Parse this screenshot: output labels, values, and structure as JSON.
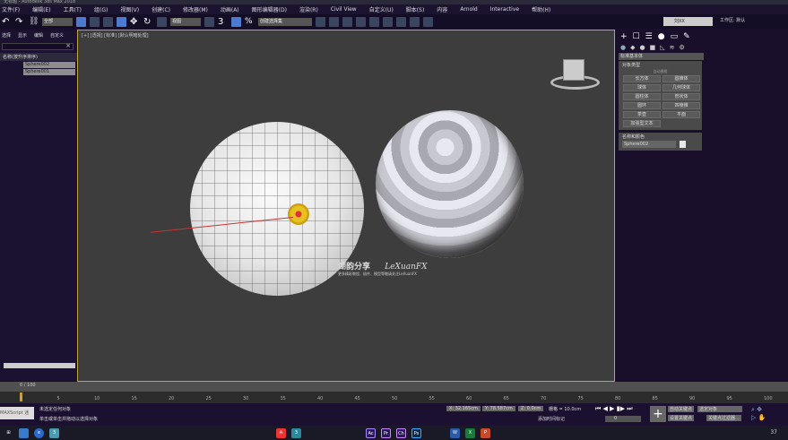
{
  "title": "无标题 - Autodesk 3ds Max 2018",
  "menu": [
    "文件(F)",
    "编辑(E)",
    "工具(T)",
    "组(G)",
    "视图(V)",
    "创建(C)",
    "修改器(M)",
    "动画(A)",
    "图形编辑器(D)",
    "渲染(R)",
    "Civil View",
    "自定义(U)",
    "脚本(S)",
    "内容",
    "Arnold",
    "Interactive",
    "帮助(H)"
  ],
  "toolbar": {
    "filter": "全部",
    "ref": "视图",
    "selset": "创建选择集"
  },
  "user": {
    "name": "刘XX",
    "workspace": "工作区: 默认"
  },
  "scene": {
    "tabs": [
      "选择",
      "显示",
      "编辑",
      "自定义"
    ],
    "header": "名称(按升序排序)",
    "objects": [
      "Sphere002",
      "Sphere001"
    ],
    "scroll": "0 / 100"
  },
  "viewport": {
    "label": "[+] [透视] [标准] [默认明暗处理]",
    "watermark": "湖韵分享",
    "watermark_en": "LeXuanFX",
    "watermark_sub": "更多精彩教程、插件、模型等敬请关注LeXuanFX"
  },
  "cmd": {
    "dropdown": "标准基本体",
    "rollout1": "对象类型",
    "autogrid": "自动栅格",
    "buttons": [
      "长方体",
      "圆锥体",
      "球体",
      "几何球体",
      "圆柱体",
      "管状体",
      "圆环",
      "四棱锥",
      "茶壶",
      "平面",
      "加强型文本"
    ],
    "rollout2": "名称和颜色",
    "name": "Sphere002",
    "color": "#e8e8e8"
  },
  "timeline": {
    "frame": "0 / 100",
    "ticks": [
      0,
      5,
      10,
      15,
      20,
      25,
      30,
      35,
      40,
      45,
      50,
      55,
      60,
      65,
      70,
      75,
      80,
      85,
      90,
      95,
      100
    ]
  },
  "status": {
    "maxscript": "MAXScript 迷",
    "line1": "未选定任何对象",
    "line2": "单击或单击并拖动以选择对象",
    "x": "X: 32.165cm",
    "y": "Y: 78.587cm",
    "z": "Z: 0.0cm",
    "grid": "栅格 = 10.0cm",
    "addtime": "添加时间标记",
    "frame": "0",
    "autokey": "自动关键点",
    "selected": "选定对象",
    "setkey": "设置关键点",
    "filters": "关键点过滤器..."
  },
  "taskbar": {
    "apps": [
      "A",
      "3",
      "Ac",
      "Pr",
      "Ch",
      "Ps",
      "W",
      "X",
      "P"
    ],
    "clock": "37"
  }
}
